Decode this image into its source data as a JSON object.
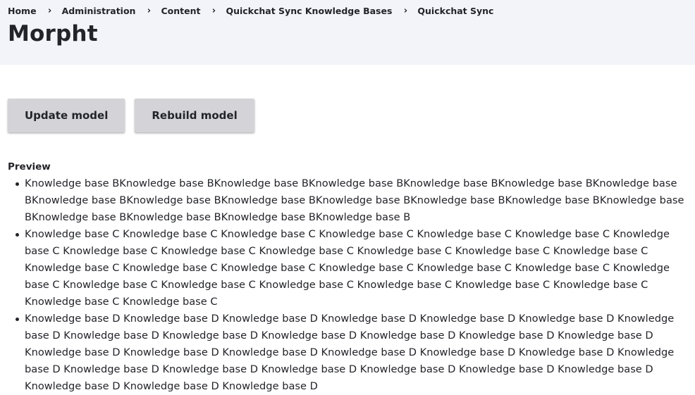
{
  "breadcrumb": [
    {
      "label": "Home"
    },
    {
      "label": "Administration"
    },
    {
      "label": "Content"
    },
    {
      "label": "Quickchat Sync Knowledge Bases"
    },
    {
      "label": "Quickchat Sync"
    }
  ],
  "breadcrumb_separator": "›",
  "page": {
    "title": "Morpht"
  },
  "actions": {
    "update_label": "Update model",
    "rebuild_label": "Rebuild model"
  },
  "preview": {
    "label": "Preview",
    "items": [
      "Knowledge base BKnowledge base BKnowledge base BKnowledge base BKnowledge base BKnowledge base BKnowledge base BKnowledge base BKnowledge base BKnowledge base BKnowledge base BKnowledge base BKnowledge base BKnowledge base BKnowledge base BKnowledge base BKnowledge base BKnowledge base B",
      "Knowledge base C Knowledge base C Knowledge base C Knowledge base C Knowledge base C Knowledge base C Knowledge base C Knowledge base C Knowledge base C Knowledge base C Knowledge base C Knowledge base C Knowledge base C Knowledge base C Knowledge base C Knowledge base C Knowledge base C Knowledge base C Knowledge base C Knowledge base C Knowledge base C Knowledge base C Knowledge base C Knowledge base C Knowledge base C Knowledge base C Knowledge base C Knowledge base C",
      "Knowledge base D Knowledge base D Knowledge base D Knowledge base D Knowledge base D Knowledge base D Knowledge base D Knowledge base D Knowledge base D Knowledge base D Knowledge base D Knowledge base D Knowledge base D Knowledge base D Knowledge base D Knowledge base D Knowledge base D Knowledge base D Knowledge base D Knowledge base D Knowledge base D Knowledge base D Knowledge base D Knowledge base D Knowledge base D Knowledge base D Knowledge base D Knowledge base D Knowledge base D"
    ]
  }
}
